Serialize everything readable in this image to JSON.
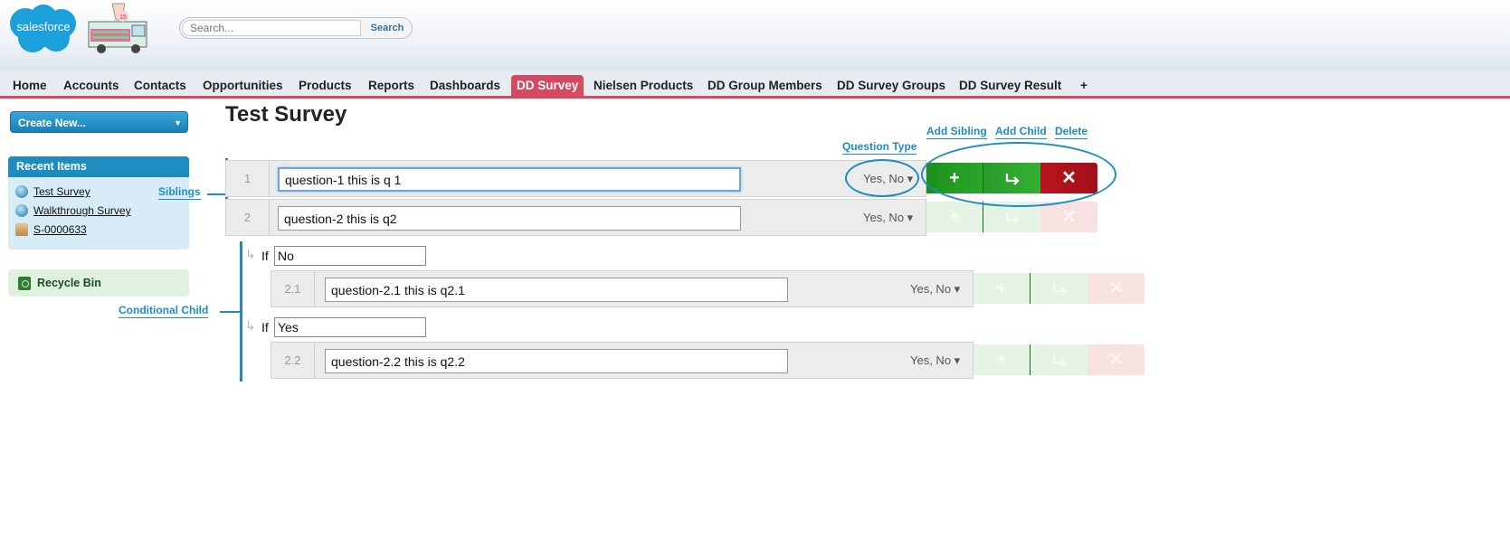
{
  "header": {
    "logo_text": "salesforce",
    "truck_badge": "15",
    "search": {
      "placeholder": "Search...",
      "button_label": "Search"
    }
  },
  "tabs": [
    {
      "label": "Home"
    },
    {
      "label": "Accounts"
    },
    {
      "label": "Contacts"
    },
    {
      "label": "Opportunities"
    },
    {
      "label": "Products"
    },
    {
      "label": "Reports"
    },
    {
      "label": "Dashboards"
    },
    {
      "label": "DD Survey",
      "active": true
    },
    {
      "label": "Nielsen Products"
    },
    {
      "label": "DD Group Members"
    },
    {
      "label": "DD Survey Groups"
    },
    {
      "label": "DD Survey Result"
    },
    {
      "label": "+"
    }
  ],
  "sidebar": {
    "create_new_label": "Create New...",
    "recent_items_title": "Recent Items",
    "recent_items": [
      {
        "label": "Test Survey",
        "icon": "survey-icon"
      },
      {
        "label": "Walkthrough Survey",
        "icon": "survey-icon"
      },
      {
        "label": "S-0000633",
        "icon": "record-icon"
      }
    ],
    "recycle_bin_label": "Recycle Bin"
  },
  "main": {
    "title": "Test Survey",
    "callouts": {
      "question_type": "Question Type",
      "add_sibling": "Add Sibling",
      "add_child": "Add Child",
      "delete": "Delete",
      "siblings": "Siblings",
      "conditional_child": "Conditional Child"
    },
    "questions": [
      {
        "number": "1",
        "text": "question-1 this is q 1",
        "type": "Yes, No ▾",
        "buttons_state": "enabled"
      },
      {
        "number": "2",
        "text": "question-2 this is q2",
        "type": "Yes, No ▾",
        "buttons_state": "disabled"
      }
    ],
    "conditions": [
      {
        "if_label": "If",
        "value": "No",
        "question": {
          "number": "2.1",
          "text": "question-2.1 this is q2.1",
          "type": "Yes, No ▾"
        }
      },
      {
        "if_label": "If",
        "value": "Yes",
        "question": {
          "number": "2.2",
          "text": "question-2.2 this is q2.2",
          "type": "Yes, No ▾"
        }
      }
    ],
    "button_glyphs": {
      "add": "+",
      "delete": "✕"
    }
  },
  "colors": {
    "accent": "#1f8cc0",
    "active_tab": "#d44a62",
    "add_green": "#1d8f1d",
    "delete_red": "#b8141f"
  }
}
